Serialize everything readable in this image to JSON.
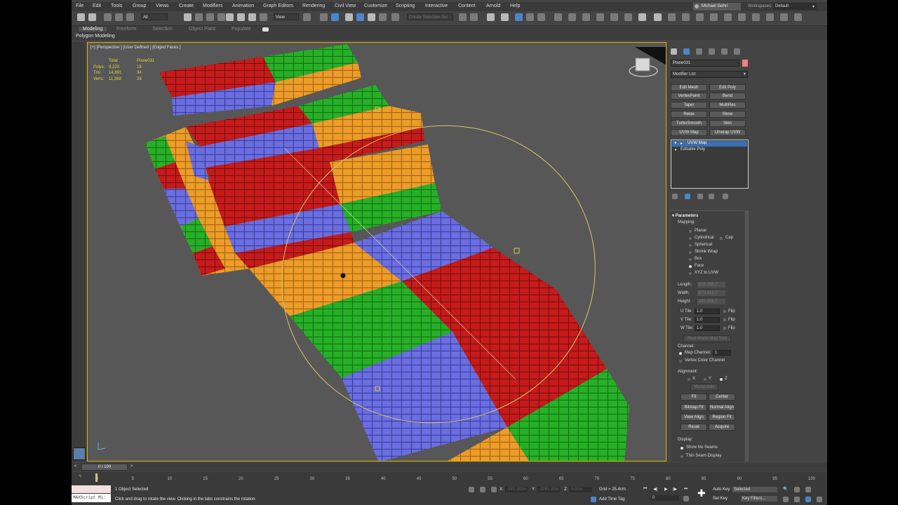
{
  "menu": [
    "File",
    "Edit",
    "Tools",
    "Group",
    "Views",
    "Create",
    "Modifiers",
    "Animation",
    "Graph Editors",
    "Rendering",
    "Civil View",
    "Customize",
    "Scripting",
    "Interactive",
    "Content",
    "Arnold",
    "Help"
  ],
  "user": "Michael Gehri",
  "workspaces_label": "Workspaces:",
  "workspace_value": "Default",
  "toolbar": {
    "selection_filter": "All",
    "ref_coord": "View",
    "selection_set": "Create Selection Set"
  },
  "ribbon": {
    "tabs": [
      "Modeling",
      "Freeform",
      "Selection",
      "Object Paint",
      "Populate"
    ],
    "active_tab": "Modeling",
    "sub": "Polygon Modeling"
  },
  "viewport": {
    "label": "[+] [Perspective ] [User Defined ] [Edged Faces ]",
    "stats": {
      "h_total": "Total",
      "h_obj": "Plane031",
      "rows": [
        {
          "k": "Polys:",
          "total": "9,223",
          "obj": "18"
        },
        {
          "k": "Tris:",
          "total": "14,891",
          "obj": "34"
        },
        {
          "k": "Verts:",
          "total": "11,388",
          "obj": "29"
        }
      ]
    }
  },
  "command_panel": {
    "object_name": "Plane031",
    "object_color": "#f08080",
    "modifier_list": "Modifier List",
    "buttons": [
      "Edit Mesh",
      "Edit Poly",
      "VertexPaint",
      "Bend",
      "Taper",
      "MultiRes",
      "Relax",
      "Skew",
      "TurboSmooth",
      "Skin",
      "UVW Map",
      "Unwrap UVW"
    ],
    "stack": [
      "UVW Map",
      "Editable Poly"
    ],
    "parameters_title": "Parameters",
    "mapping_label": "Mapping:",
    "mapping_options": [
      "Planar",
      "Cylindrical",
      "Spherical",
      "Shrink Wrap",
      "Box",
      "Face",
      "XYZ to UVW"
    ],
    "mapping_selected": "Face",
    "cap_label": "Cap",
    "length_label": "Length:",
    "length_value": "826.356.7",
    "width_label": "Width:",
    "width_value": "670.419.7",
    "height_label": "Height:",
    "height_value": "243.856.7",
    "u_tile": "U Tile:",
    "v_tile": "V Tile:",
    "w_tile": "W Tile:",
    "tile_value": "1.0",
    "flip": "Flip",
    "real_world": "Real-World Map Size",
    "channel_label": "Channel:",
    "map_channel": "Map Channel:",
    "map_channel_value": "1",
    "vertex_color_channel": "Vertex Color Channel",
    "alignment_label": "Alignment:",
    "axis": [
      "X",
      "Y",
      "Z"
    ],
    "manipulate": "Manipulate",
    "align_buttons": [
      "Fit",
      "Center",
      "Bitmap Fit",
      "Normal Align",
      "View Align",
      "Region Fit",
      "Reset",
      "Acquire"
    ],
    "display_label": "Display:",
    "show_no_seams": "Show No Seams",
    "thin_seam": "Thin Seam Display"
  },
  "timeline": {
    "frame": "0 / 100",
    "ticks": [
      "0",
      "5",
      "10",
      "15",
      "20",
      "25",
      "30",
      "35",
      "40",
      "45",
      "50",
      "55",
      "60",
      "65",
      "70",
      "75",
      "80",
      "85",
      "90",
      "95",
      "100"
    ]
  },
  "status": {
    "maxscript": "MAXScript Mi:",
    "selected": "1 Object Selected",
    "prompt": "Click and drag to rotate the view.  Clicking in the tabs constrains the rotation",
    "x_label": "X:",
    "y_label": "Y:",
    "z_label": "Z:",
    "x_value": "-345.283m",
    "y_value": "-2081.35m",
    "z_value": "0.0cm",
    "grid": "Grid = 25.4cm",
    "add_time_tag": "Add Time Tag",
    "auto_key": "Auto Key",
    "set_key": "Set Key",
    "selected_dd": "Selected",
    "key_filters": "Key Filters...",
    "frame_field": "0"
  }
}
